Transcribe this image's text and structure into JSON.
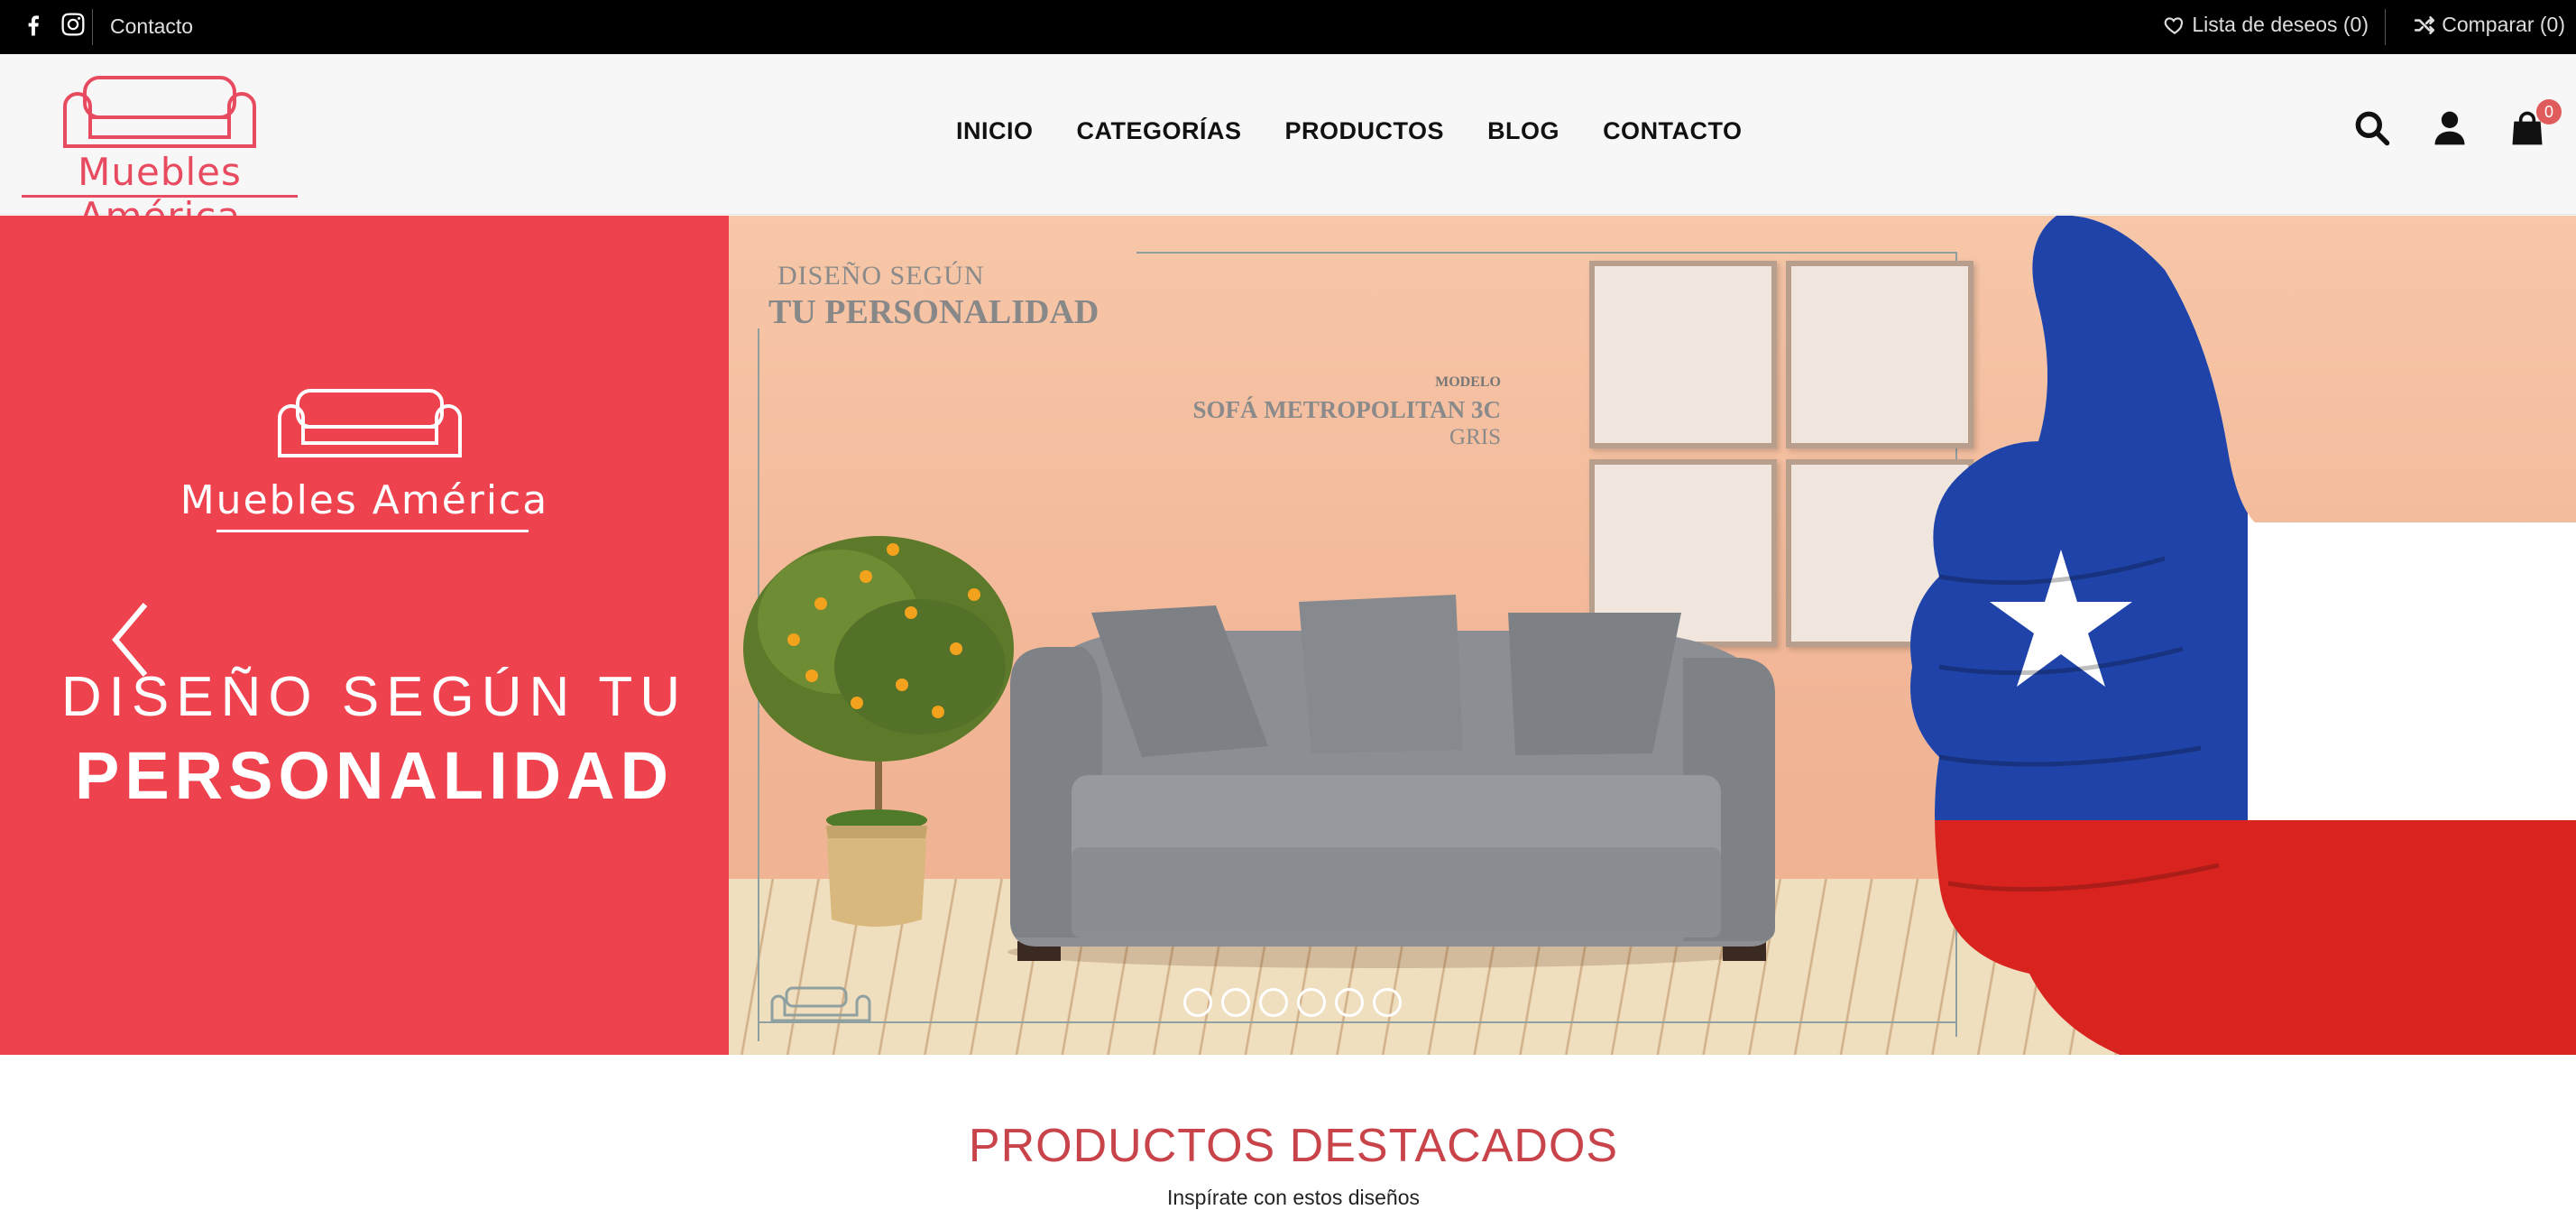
{
  "topbar": {
    "contact": "Contacto",
    "wishlist": "Lista de deseos (0)",
    "compare": "Comparar (0)"
  },
  "brand": {
    "name": "Muebles América",
    "accent": "#e84a5f"
  },
  "nav": {
    "items": [
      "INICIO",
      "CATEGORÍAS",
      "PRODUCTOS",
      "BLOG",
      "CONTACTO"
    ]
  },
  "header": {
    "cart_count": "0"
  },
  "hero": {
    "brand": "Muebles América",
    "title_line1": "DISEÑO SEGÚN TU",
    "title_line2": "PERSONALIDAD",
    "caption_line1": "DISEÑO SEGÚN",
    "caption_line2": "TU PERSONALIDAD",
    "model_label": "MODELO",
    "model_name": "SOFÁ METROPOLITAN 3C",
    "model_color": "GRIS",
    "slide_count": 6,
    "panel_color": "#ef424f"
  },
  "featured": {
    "title": "PRODUCTOS DESTACADOS",
    "subtitle": "Inspírate con estos diseños"
  }
}
